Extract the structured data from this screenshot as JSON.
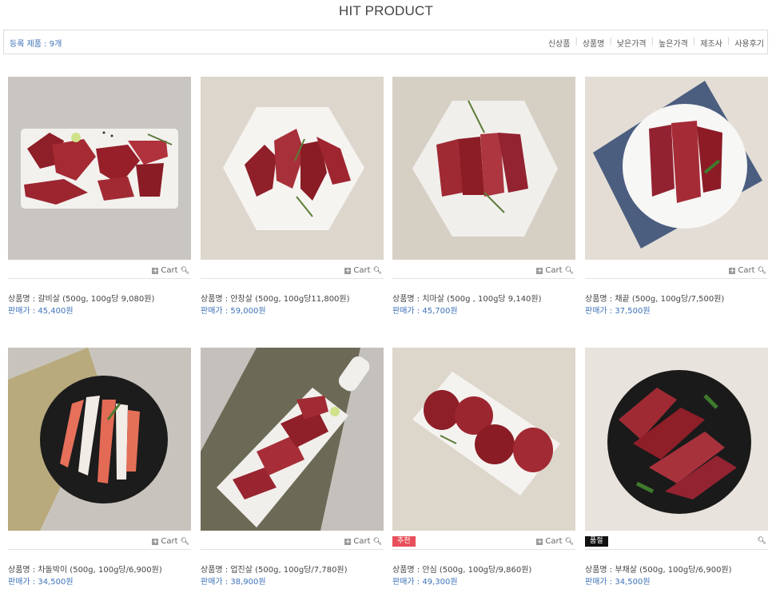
{
  "header": {
    "title": "HIT PRODUCT"
  },
  "toolbar": {
    "count_label": "등록 제품 : 9개",
    "sort_options": [
      "신상품",
      "상품명",
      "낮은가격",
      "높은가격",
      "제조사",
      "사용후기"
    ]
  },
  "colors": {
    "link": "#3d73b8",
    "badge_recommend": "#e8505b",
    "badge_soldout": "#111111"
  },
  "cart_label": "Cart",
  "products": [
    {
      "name": "상품명 : 갈비살 (500g, 100g당 9,080원)",
      "price": "판매가 : 45,400원",
      "badge": ""
    },
    {
      "name": "상품명 : 안창살 (500g, 100g당11,800원)",
      "price": "판매가 : 59,000원",
      "badge": ""
    },
    {
      "name": "상품명 : 치마살 (500g , 100g당 9,140원)",
      "price": "판매가 : 45,700원",
      "badge": ""
    },
    {
      "name": "상품명 : 채끝 (500g, 100g당/7,500원)",
      "price": "판매가 : 37,500원",
      "badge": ""
    },
    {
      "name": "상품명 : 차돌박이 (500g, 100g당/6,900원)",
      "price": "판매가 : 34,500원",
      "badge": ""
    },
    {
      "name": "상품명 : 업진살 (500g, 100g당/7,780원)",
      "price": "판매가 : 38,900원",
      "badge": ""
    },
    {
      "name": "상품명 : 안심 (500g, 100g당/9,860원)",
      "price": "판매가 : 49,300원",
      "badge": "추천"
    },
    {
      "name": "상품명 : 부채살 (500g, 100g당/6,900원)",
      "price": "판매가 : 34,500원",
      "badge": "품절"
    }
  ]
}
